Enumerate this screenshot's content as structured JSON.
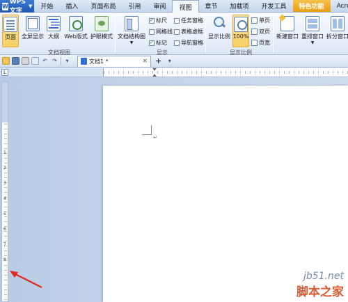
{
  "app": {
    "name": "WPS 文字",
    "logo": "W"
  },
  "menu_tabs": [
    "开始",
    "插入",
    "页面布局",
    "引用",
    "审阅",
    "视图",
    "章节",
    "加载项",
    "开发工具",
    "特色功能",
    "Acrobat"
  ],
  "active_tab": "视图",
  "ribbon": {
    "doc_views": {
      "page": "页面",
      "fullscreen": "全屏显示",
      "outline": "大纲",
      "web": "Web版式",
      "eye": "护眼模式",
      "group": "文档视图"
    },
    "structure": {
      "label": "文档结构图"
    },
    "show": {
      "group": "显示",
      "ruler": "标尺",
      "grid": "网格线",
      "mark": "标记",
      "taskpane": "任务窗格",
      "table_grid": "表格虚框",
      "nav_grid": "导航窗格"
    },
    "zoom": {
      "zoom_label": "显示比例",
      "pct_label": "100%",
      "one_page": "单页",
      "two_page": "双页",
      "page_width": "页宽",
      "group": "显示比例"
    },
    "window": {
      "new_win": "新建窗口",
      "rearrange": "重排窗口",
      "split": "拆分窗口"
    }
  },
  "doc_tab": {
    "title": "文档1 *",
    "close": "×",
    "add": "+"
  },
  "vruler_nums": [
    "1",
    "2",
    "3",
    "4",
    "5",
    "6",
    "7",
    "8"
  ],
  "watermark": {
    "url": "jb51.net",
    "site": "脚本之家"
  },
  "accent": "#1f56b0"
}
